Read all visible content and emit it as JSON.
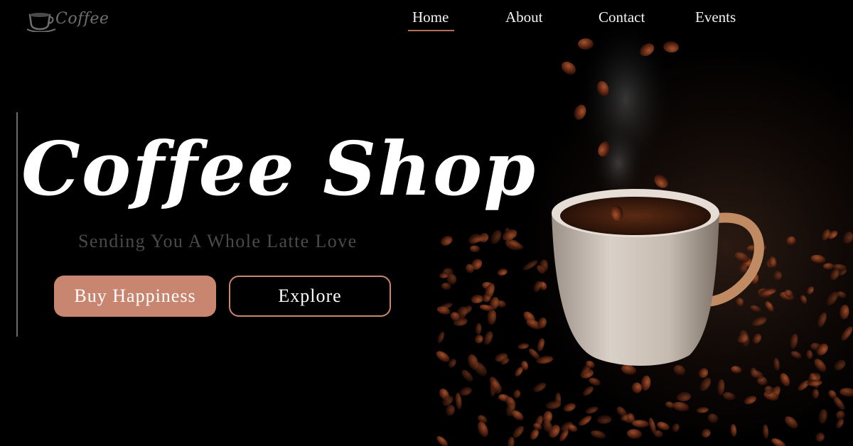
{
  "brand": {
    "logo_text": "Coffee",
    "accent_color": "#c88670"
  },
  "nav": {
    "items": [
      {
        "label": "Home",
        "active": true
      },
      {
        "label": "About",
        "active": false
      },
      {
        "label": "Contact",
        "active": false
      },
      {
        "label": "Events",
        "active": false
      }
    ]
  },
  "hero": {
    "title": "Coffee Shop",
    "subtitle": "Sending You A Whole Latte Love",
    "primary_button": "Buy Happiness",
    "secondary_button": "Explore"
  }
}
